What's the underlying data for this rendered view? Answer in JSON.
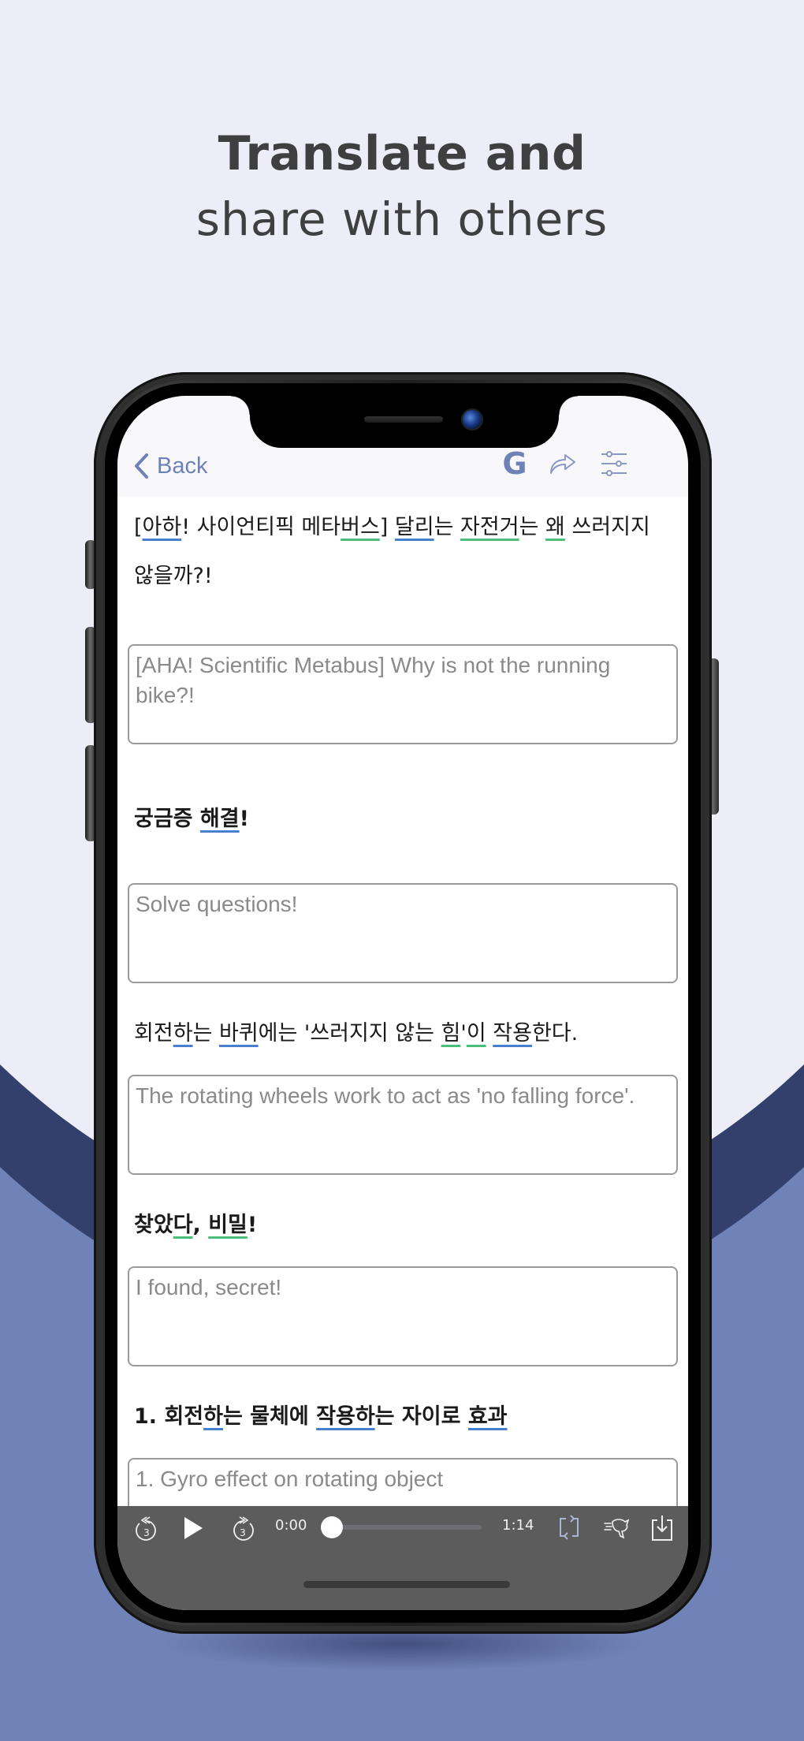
{
  "headline": {
    "line1": "Translate and",
    "line2": "share with others"
  },
  "colors": {
    "background_light": "#ededf8",
    "wave_dark": "#33406d",
    "wave_light": "#7083b8",
    "accent": "#6e82b8",
    "underline_blue": "#4a7fd0",
    "underline_green": "#4cbe7a",
    "player_bg": "#5c5c5c"
  },
  "navbar": {
    "back_label": "Back",
    "icons": [
      "chevron-left-icon",
      "google-translate-icon",
      "share-icon",
      "settings-sliders-icon"
    ],
    "google_glyph": "G"
  },
  "segments": [
    {
      "source_parts": [
        {
          "t": "[",
          "u": ""
        },
        {
          "t": "아하",
          "u": "blue"
        },
        {
          "t": "! 사이언티픽 메타",
          "u": ""
        },
        {
          "t": "버스",
          "u": "green"
        },
        {
          "t": "] ",
          "u": ""
        },
        {
          "t": "달리",
          "u": "blue"
        },
        {
          "t": "는 ",
          "u": ""
        },
        {
          "t": "자전거",
          "u": "green"
        },
        {
          "t": "는 ",
          "u": ""
        },
        {
          "t": "왜",
          "u": "green"
        },
        {
          "t": " 쓰러지지 않을까?!",
          "u": ""
        }
      ],
      "bold": false,
      "translation": "[AHA! Scientific Metabus] Why is not the running bike?!"
    },
    {
      "source_parts": [
        {
          "t": "궁금증 ",
          "u": ""
        },
        {
          "t": "해결",
          "u": "blue"
        },
        {
          "t": "!",
          "u": ""
        }
      ],
      "bold": true,
      "translation": "Solve questions!"
    },
    {
      "source_parts": [
        {
          "t": "회전",
          "u": ""
        },
        {
          "t": "하",
          "u": "blue"
        },
        {
          "t": "는 ",
          "u": ""
        },
        {
          "t": "바퀴",
          "u": "blue"
        },
        {
          "t": "에는 '쓰러지지 않는 ",
          "u": ""
        },
        {
          "t": "힘",
          "u": "green"
        },
        {
          "t": "'",
          "u": ""
        },
        {
          "t": "이",
          "u": "green"
        },
        {
          "t": " ",
          "u": ""
        },
        {
          "t": "작용",
          "u": "blue"
        },
        {
          "t": "한다.",
          "u": ""
        }
      ],
      "bold": false,
      "translation": "The rotating wheels work to act as 'no falling force'."
    },
    {
      "source_parts": [
        {
          "t": "찾았",
          "u": ""
        },
        {
          "t": "다",
          "u": "green"
        },
        {
          "t": ", ",
          "u": ""
        },
        {
          "t": "비밀",
          "u": "green"
        },
        {
          "t": "!",
          "u": ""
        }
      ],
      "bold": true,
      "translation": "I found, secret!"
    },
    {
      "source_parts": [
        {
          "t": "1. 회전",
          "u": ""
        },
        {
          "t": "하",
          "u": "blue"
        },
        {
          "t": "는 물체에 ",
          "u": ""
        },
        {
          "t": "작용하",
          "u": "blue"
        },
        {
          "t": "는 자이로 ",
          "u": ""
        },
        {
          "t": "효과",
          "u": "blue"
        }
      ],
      "bold": true,
      "translation": "1. Gyro effect on rotating object"
    }
  ],
  "player": {
    "rewind_seconds": "3",
    "forward_seconds": "3",
    "current_time": "0:00",
    "total_time": "1:14",
    "progress_fraction": 0.0,
    "icons": [
      "rewind-3s-icon",
      "play-icon",
      "forward-3s-icon",
      "repeat-icon",
      "speed-rabbit-icon",
      "download-icon"
    ]
  }
}
